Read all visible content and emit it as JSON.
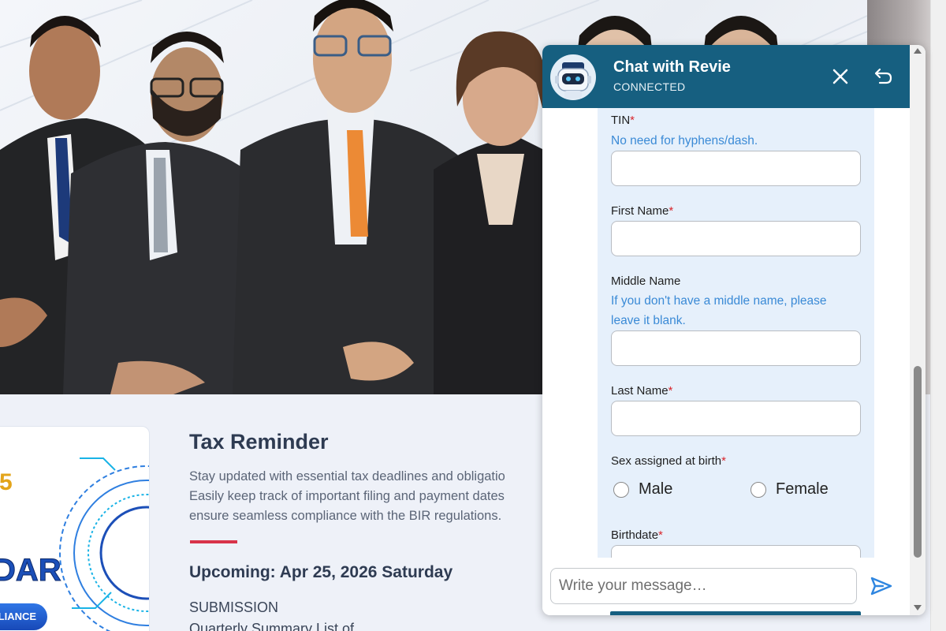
{
  "chat": {
    "title": "Chat with Revie",
    "status": "CONNECTED",
    "form": {
      "tin_label": "TIN",
      "tin_hint": "No need for hyphens/dash.",
      "first_name_label": "First Name",
      "middle_name_label": "Middle Name",
      "middle_name_hint_line1": "If you don't have a middle name, please",
      "middle_name_hint_line2": "leave it blank.",
      "last_name_label": "Last Name",
      "sex_label": "Sex assigned at birth",
      "sex_options": [
        "Male",
        "Female"
      ],
      "birthdate_label": "Birthdate",
      "required_mark": "*"
    },
    "composer": {
      "placeholder": "Write your message…"
    }
  },
  "page": {
    "tax_title": "Tax Reminder",
    "tax_desc_lines": [
      "Stay updated with essential tax deadlines and obligatio",
      "Easily keep track of important filing and payment dates",
      "ensure seamless compliance with the BIR regulations."
    ],
    "upcoming": "Upcoming: Apr 25, 2026 Saturday",
    "submission": "SUBMISSION",
    "submission_detail": "Quarterly Summary List of",
    "calendar_digit": "5",
    "calendar_word": "DAR",
    "calendar_badge": "PLIANCE"
  },
  "colors": {
    "chat_header": "#165f80",
    "form_bg": "#e6f0fb",
    "hint_blue": "#3a8ad6",
    "required_red": "#d9262c",
    "accent_red": "#d8334a",
    "send_blue": "#2f86e0"
  },
  "icons": {
    "close": "close-icon",
    "back": "undo-arrow-icon",
    "send": "send-icon",
    "avatar": "robot-avatar-icon"
  }
}
